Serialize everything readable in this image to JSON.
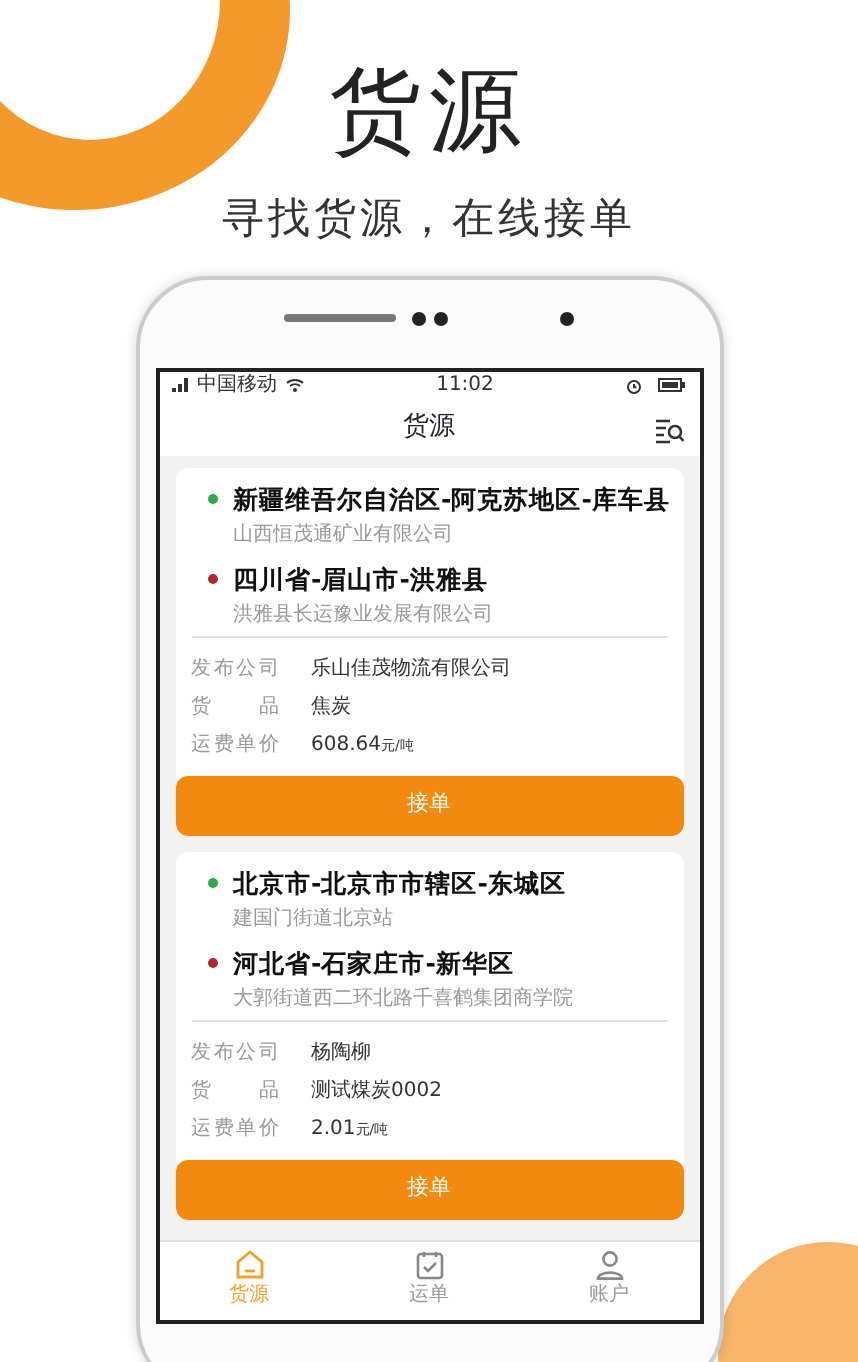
{
  "headline": "货源",
  "tagline": "寻找货源，在线接单",
  "status_bar": {
    "carrier": "中国移动",
    "time": "11:02"
  },
  "header": {
    "title": "货源"
  },
  "orders": [
    {
      "stops": [
        {
          "place": "新疆维吾尔自治区-阿克苏地区-库车县",
          "address": "山西恒茂通矿业有限公司",
          "color": "#2eaa4a"
        },
        {
          "place": "四川省-眉山市-洪雅县",
          "address": "洪雅县长运豫业发展有限公司",
          "color": "#b3262b"
        }
      ],
      "details": [
        {
          "label": "发布公司",
          "value": "乐山佳茂物流有限公司"
        },
        {
          "label": "货品",
          "value": "焦炭"
        },
        {
          "label": "运费单价",
          "value": "608.64",
          "unit": "元/吨"
        }
      ],
      "action": "接单"
    },
    {
      "stops": [
        {
          "place": "北京市-北京市市辖区-东城区",
          "address": "建国门街道北京站",
          "color": "#2eaa4a"
        },
        {
          "place": "河北省-石家庄市-新华区",
          "address": "大郭街道西二环北路千喜鹤集团商学院",
          "color": "#b3262b"
        }
      ],
      "details": [
        {
          "label": "发布公司",
          "value": "杨陶柳"
        },
        {
          "label": "货品",
          "value": "测试煤炭0002"
        },
        {
          "label": "运费单价",
          "value": "2.01",
          "unit": "元/吨"
        }
      ],
      "action": "接单"
    }
  ],
  "tabs": [
    {
      "label": "货源",
      "selected": true
    },
    {
      "label": "运单",
      "selected": false
    },
    {
      "label": "账户",
      "selected": false
    }
  ]
}
